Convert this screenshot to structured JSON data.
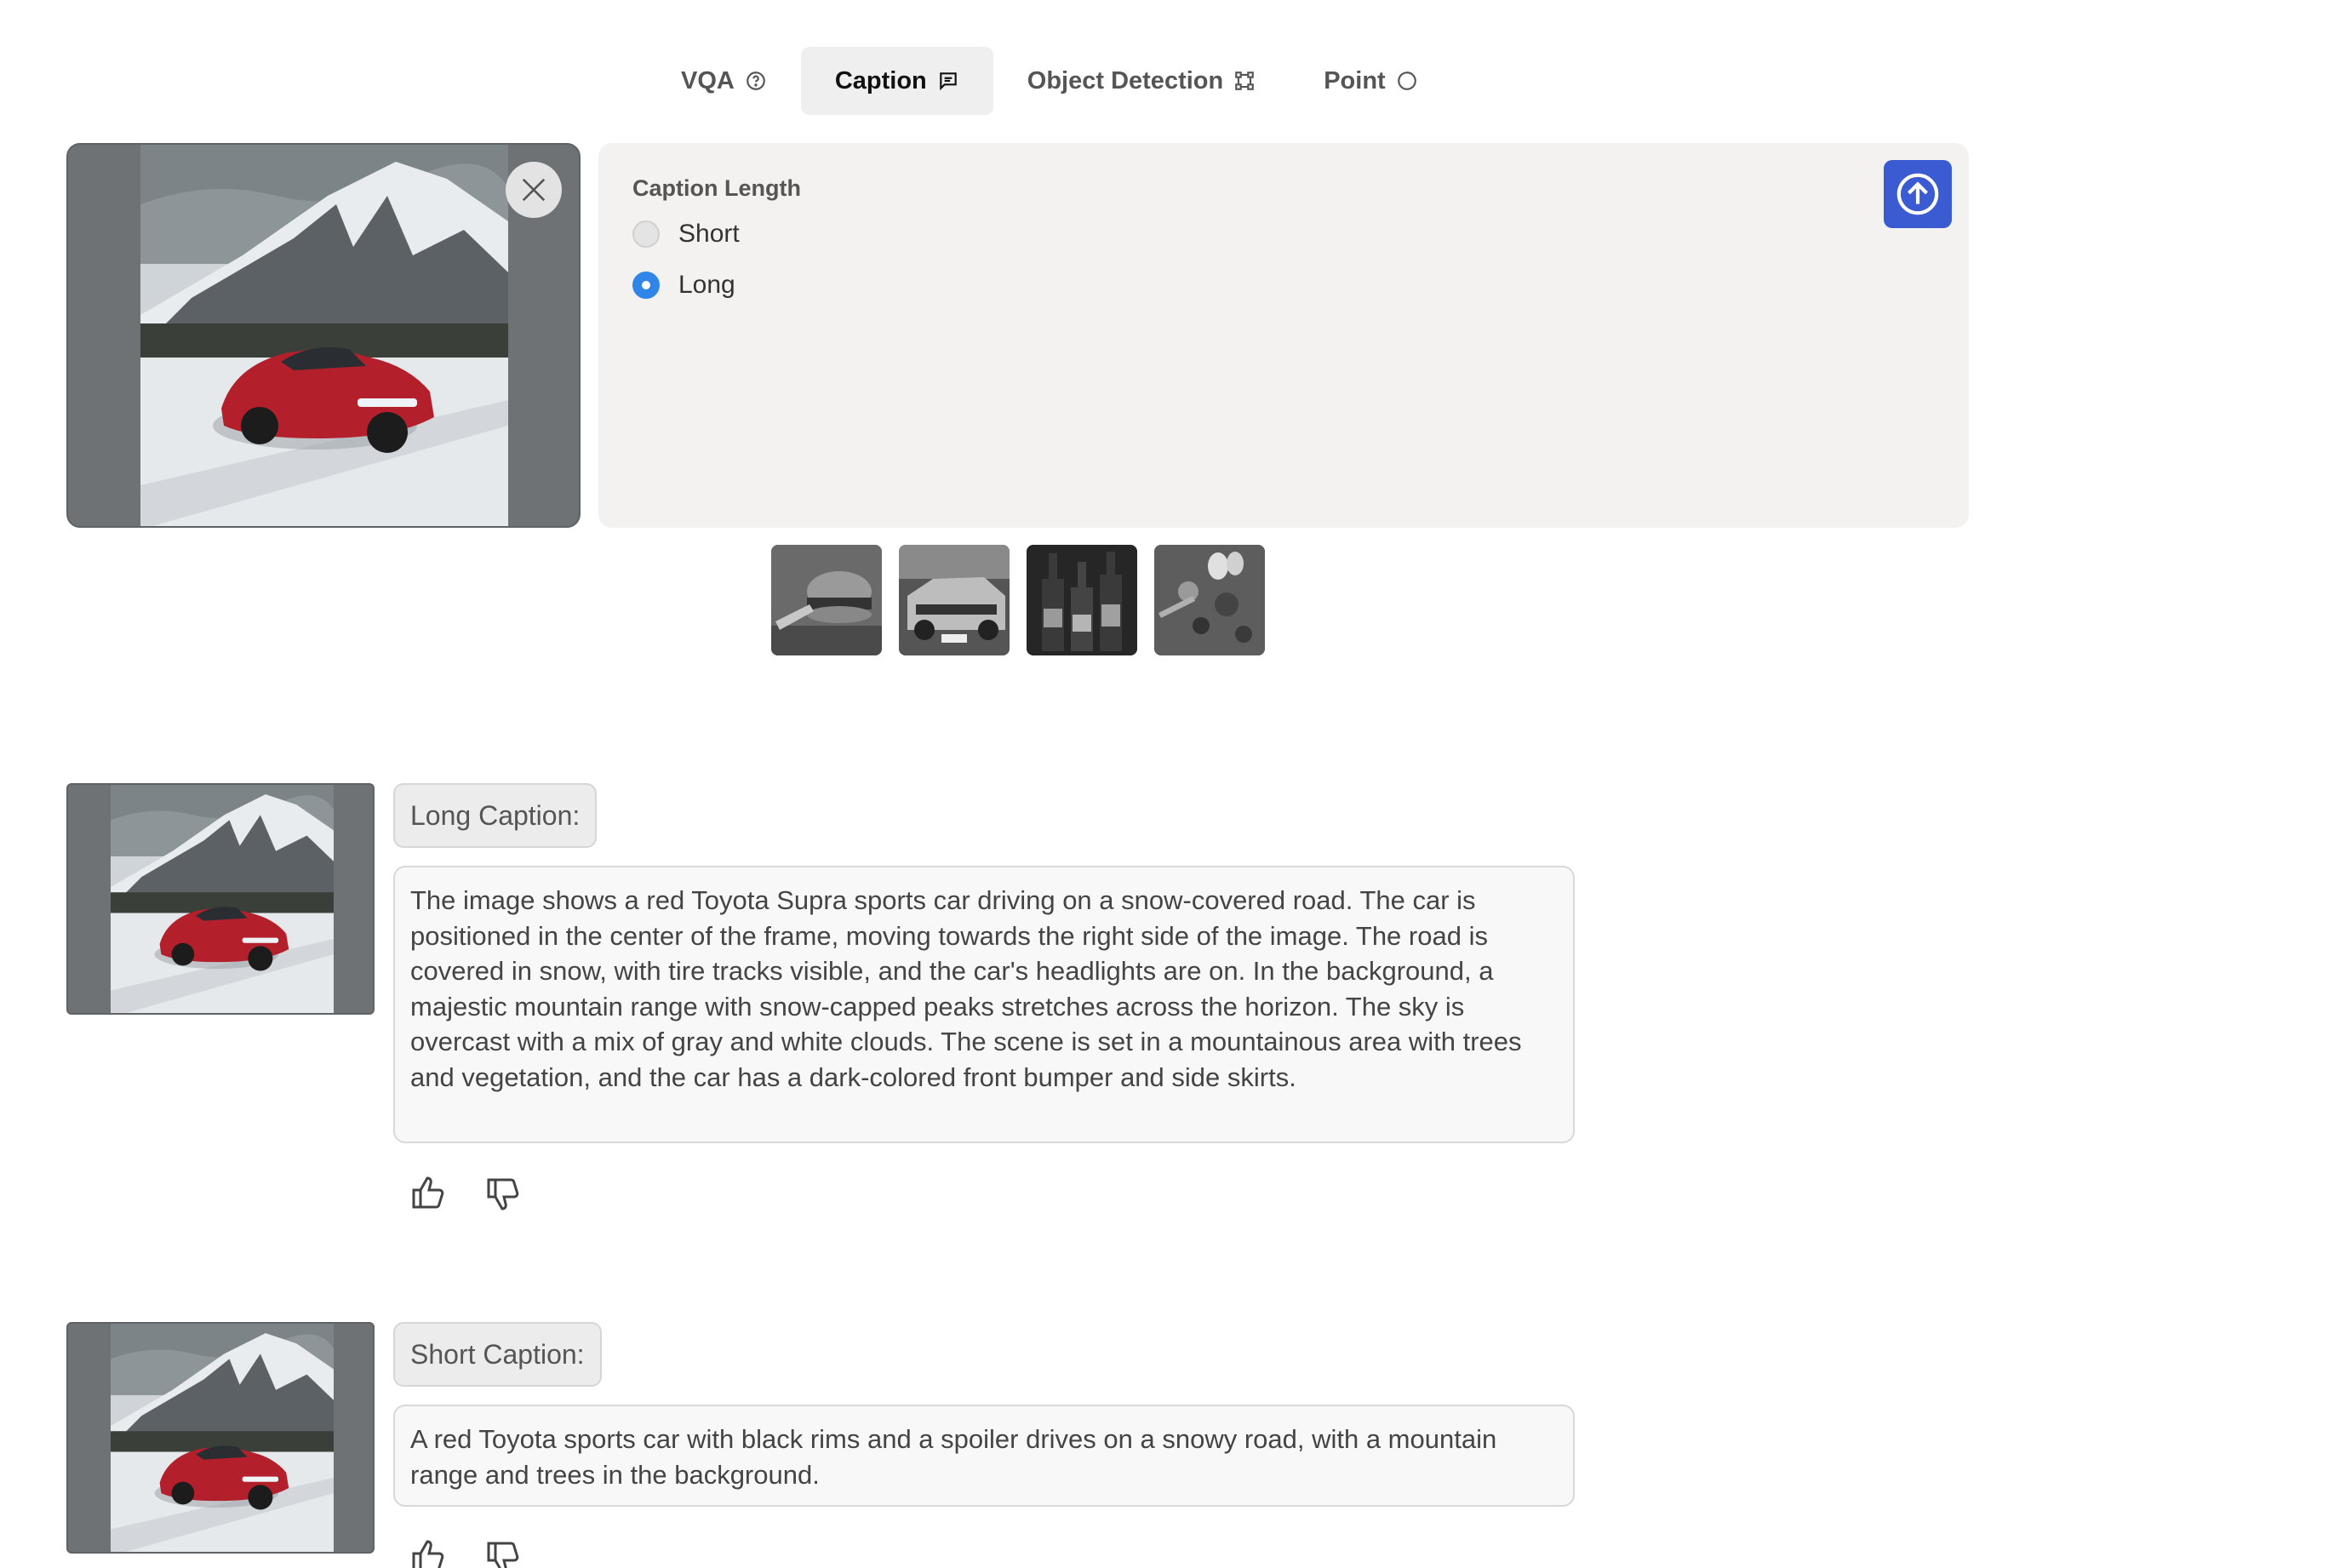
{
  "tabs": [
    {
      "label": "VQA",
      "icon": "question-circle-icon",
      "active": false
    },
    {
      "label": "Caption",
      "icon": "message-square-icon",
      "active": true
    },
    {
      "label": "Object Detection",
      "icon": "bounding-box-icon",
      "active": false
    },
    {
      "label": "Point",
      "icon": "circle-icon",
      "active": false
    }
  ],
  "options": {
    "title": "Caption Length",
    "choices": [
      {
        "label": "Short",
        "selected": false
      },
      {
        "label": "Long",
        "selected": true
      }
    ]
  },
  "samples": [
    "burger-sample",
    "car-sample",
    "bottles-sample",
    "vegetables-sample"
  ],
  "results": [
    {
      "label": "Long Caption:",
      "text": "The image shows a red Toyota Supra sports car driving on a snow-covered road. The car is positioned in the center of the frame, moving towards the right side of the image. The road is covered in snow, with tire tracks visible, and the car's headlights are on. In the background, a majestic mountain range with snow-capped peaks stretches across the horizon. The sky is overcast with a mix of gray and white clouds. The scene is set in a mountainous area with trees and vegetation, and the car has a dark-colored front bumper and side skirts."
    },
    {
      "label": "Short Caption:",
      "text": "A red Toyota sports car with black rims and a spoiler drives on a snowy road, with a mountain range and trees in the background."
    }
  ],
  "colors": {
    "accent": "#3a5bd1",
    "radio_selected": "#2f86e8",
    "panel_bg": "#f3f2f1"
  }
}
